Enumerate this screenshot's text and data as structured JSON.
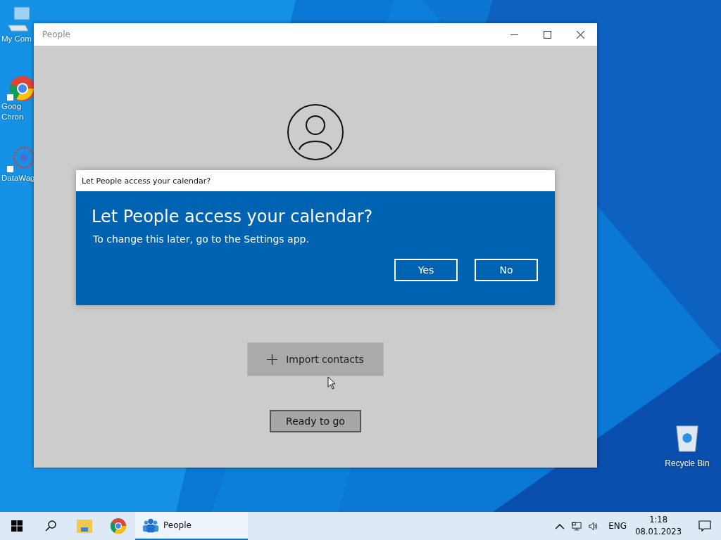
{
  "desktop": {
    "icons": [
      {
        "kind": "computer",
        "label": "My Com"
      },
      {
        "kind": "chrome",
        "label": "Goog Chron"
      },
      {
        "kind": "network",
        "label": "DataWag"
      }
    ],
    "recycle_bin": {
      "label": "Recycle Bin"
    }
  },
  "window": {
    "title": "People",
    "import_button": "Import contacts",
    "ready_button": "Ready to go"
  },
  "dialog": {
    "title": "Let People access your calendar?",
    "heading": "Let People access your calendar?",
    "message": "To change this later, go to the Settings app.",
    "buttons": [
      "Yes",
      "No"
    ]
  },
  "taskbar": {
    "items": [
      {
        "kind": "start",
        "selected": false
      },
      {
        "kind": "search",
        "selected": false
      },
      {
        "kind": "folder",
        "selected": false
      },
      {
        "kind": "chrome",
        "selected": false
      },
      {
        "kind": "people",
        "label": "People",
        "selected": true
      }
    ],
    "language": "ENG",
    "time": "1:18",
    "date": "08.01.2023"
  }
}
